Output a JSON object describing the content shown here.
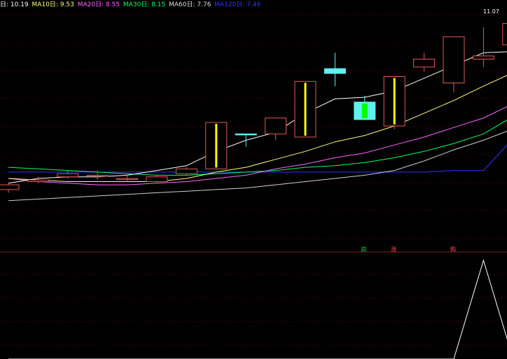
{
  "legend": {
    "ma5_text": "日: 10.19",
    "ma10_text": "MA10日: 9.53",
    "ma20_text": "MA20日: 8.55",
    "ma30_text": "MA30日: 8.15",
    "ma60_text": "MA60日: 7.76",
    "ma120_text": "MA120日: 7.46"
  },
  "colors": {
    "background": "#000000",
    "grid": "#3a0000",
    "divider": "#8a1e1e",
    "up_candle": "#e05a5a",
    "down_candle": "#5ff0f0",
    "bull_bar": "#ffff00",
    "bear_bar": "#00ff00",
    "ma5": "#ffffff",
    "ma10": "#ffff80",
    "ma20": "#ff66ff",
    "ma30": "#00ff66",
    "ma60": "#cfcfcf",
    "ma120": "#3333ff",
    "indicator": "#ffffff"
  },
  "chart_data": {
    "type": "candlestick",
    "price_range": [
      4.0,
      11.5
    ],
    "max_label": "11.07",
    "candles": [
      {
        "o": 5.85,
        "c": 6.0,
        "h": 6.05,
        "l": 5.75
      },
      {
        "o": 6.1,
        "c": 6.15,
        "h": 6.25,
        "l": 6.05
      },
      {
        "o": 6.25,
        "c": 6.35,
        "h": 6.45,
        "l": 6.2
      },
      {
        "o": 6.3,
        "c": 6.3,
        "h": 6.45,
        "l": 6.15
      },
      {
        "o": 6.2,
        "c": 6.2,
        "h": 6.35,
        "l": 6.1
      },
      {
        "o": 6.1,
        "c": 6.25,
        "h": 6.3,
        "l": 6.05
      },
      {
        "o": 6.35,
        "c": 6.5,
        "h": 6.55,
        "l": 6.3
      },
      {
        "o": 6.5,
        "c": 7.96,
        "h": 7.96,
        "l": 6.5,
        "bar": "bull"
      },
      {
        "o": 7.6,
        "c": 7.6,
        "h": 7.6,
        "l": 7.2,
        "down": true
      },
      {
        "o": 7.6,
        "c": 8.1,
        "h": 8.1,
        "l": 7.4
      },
      {
        "o": 7.5,
        "c": 9.25,
        "h": 9.25,
        "l": 7.5,
        "bar": "bull"
      },
      {
        "o": 9.65,
        "c": 9.5,
        "h": 10.15,
        "l": 9.1,
        "down": true
      },
      {
        "o": 8.6,
        "c": 8.05,
        "h": 8.8,
        "l": 8.05,
        "down": true,
        "bar": "bear"
      },
      {
        "o": 7.85,
        "c": 9.4,
        "h": 9.4,
        "l": 7.75,
        "bar": "bull"
      },
      {
        "o": 9.7,
        "c": 9.95,
        "h": 10.15,
        "l": 9.55
      },
      {
        "o": 9.2,
        "c": 10.65,
        "h": 10.65,
        "l": 8.9
      },
      {
        "o": 9.95,
        "c": 10.05,
        "h": 10.95,
        "l": 9.7
      },
      {
        "o": 10.4,
        "c": 11.07,
        "h": 11.07,
        "l": 10.4,
        "bar": "bull"
      }
    ],
    "ma5": [
      6.05,
      6.2,
      6.25,
      6.25,
      6.3,
      6.45,
      6.6,
      7.05,
      7.4,
      7.65,
      8.25,
      8.7,
      8.75,
      8.95,
      9.35,
      9.75,
      10.15,
      10.19
    ],
    "ma10": [
      6.2,
      6.15,
      6.1,
      6.1,
      6.1,
      6.1,
      6.2,
      6.4,
      6.55,
      6.8,
      7.05,
      7.35,
      7.55,
      7.85,
      8.25,
      8.65,
      9.1,
      9.53
    ],
    "ma20": [
      6.2,
      6.1,
      6.05,
      6.0,
      6.0,
      6.05,
      6.1,
      6.2,
      6.3,
      6.5,
      6.65,
      6.85,
      7.0,
      7.25,
      7.5,
      7.8,
      8.1,
      8.55
    ],
    "ma30": [
      6.55,
      6.5,
      6.45,
      6.4,
      6.35,
      6.3,
      6.3,
      6.35,
      6.4,
      6.45,
      6.55,
      6.6,
      6.7,
      6.85,
      7.05,
      7.3,
      7.6,
      8.15
    ],
    "ma60": [
      5.5,
      5.55,
      5.6,
      5.65,
      5.7,
      5.75,
      5.8,
      5.85,
      5.9,
      6.0,
      6.1,
      6.2,
      6.3,
      6.45,
      6.75,
      7.1,
      7.4,
      7.76
    ],
    "ma120": [
      6.4,
      6.4,
      6.4,
      6.4,
      6.4,
      6.4,
      6.4,
      6.4,
      6.4,
      6.4,
      6.4,
      6.4,
      6.4,
      6.4,
      6.4,
      6.45,
      6.45,
      7.46
    ],
    "markers": [
      {
        "index": 12,
        "label": "跌",
        "color": "#00cc44"
      },
      {
        "index": 13,
        "label": "涨",
        "color": "#ff5555"
      },
      {
        "index": 15,
        "label": "购",
        "color": "#ff5555"
      }
    ],
    "indicator": [
      0,
      0,
      0,
      0,
      0,
      0,
      0,
      0,
      0,
      0,
      0,
      0,
      0,
      0,
      0,
      0,
      1,
      0
    ]
  }
}
